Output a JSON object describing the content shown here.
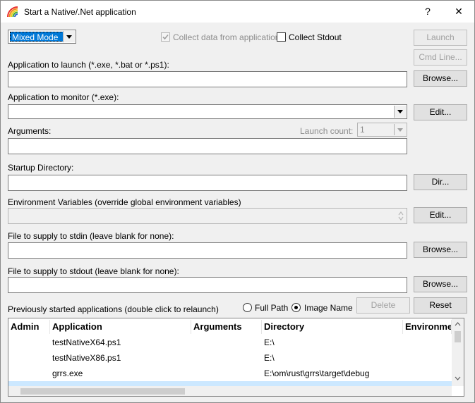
{
  "window": {
    "title": "Start a Native/.Net application",
    "help": "?",
    "close": "✕"
  },
  "mode": {
    "selected": "Mixed Mode"
  },
  "options": {
    "collect_data": "Collect data from application",
    "collect_stdout": "Collect Stdout"
  },
  "buttons": {
    "launch": "Launch",
    "cmdline": "Cmd Line...",
    "browse": "Browse...",
    "edit": "Edit...",
    "dir": "Dir...",
    "delete": "Delete",
    "reset": "Reset"
  },
  "labels": {
    "app_launch": "Application to launch (*.exe, *.bat or *.ps1):",
    "app_monitor": "Application to monitor (*.exe):",
    "arguments": "Arguments:",
    "launch_count": "Launch count:",
    "launch_count_value": "1",
    "startup_dir": "Startup Directory:",
    "env_vars": "Environment Variables (override global environment variables)",
    "stdin": "File to supply to stdin (leave blank for none):",
    "stdout": "File to supply to stdout (leave blank for none):",
    "previous": "Previously started applications (double click to relaunch)",
    "full_path": "Full Path",
    "image_name": "Image Name"
  },
  "table": {
    "columns": [
      "Admin",
      "Application",
      "Arguments",
      "Directory",
      "Environment"
    ],
    "rows": [
      {
        "admin": "",
        "application": "testNativeX64.ps1",
        "arguments": "",
        "directory": "E:\\",
        "environment": ""
      },
      {
        "admin": "",
        "application": "testNativeX86.ps1",
        "arguments": "",
        "directory": "E:\\",
        "environment": ""
      },
      {
        "admin": "",
        "application": "grrs.exe",
        "arguments": "",
        "directory": "E:\\om\\rust\\grrs\\target\\debug",
        "environment": ""
      }
    ]
  },
  "colors": {
    "selection": "#0078d7",
    "row_highlight": "#cce8ff"
  }
}
